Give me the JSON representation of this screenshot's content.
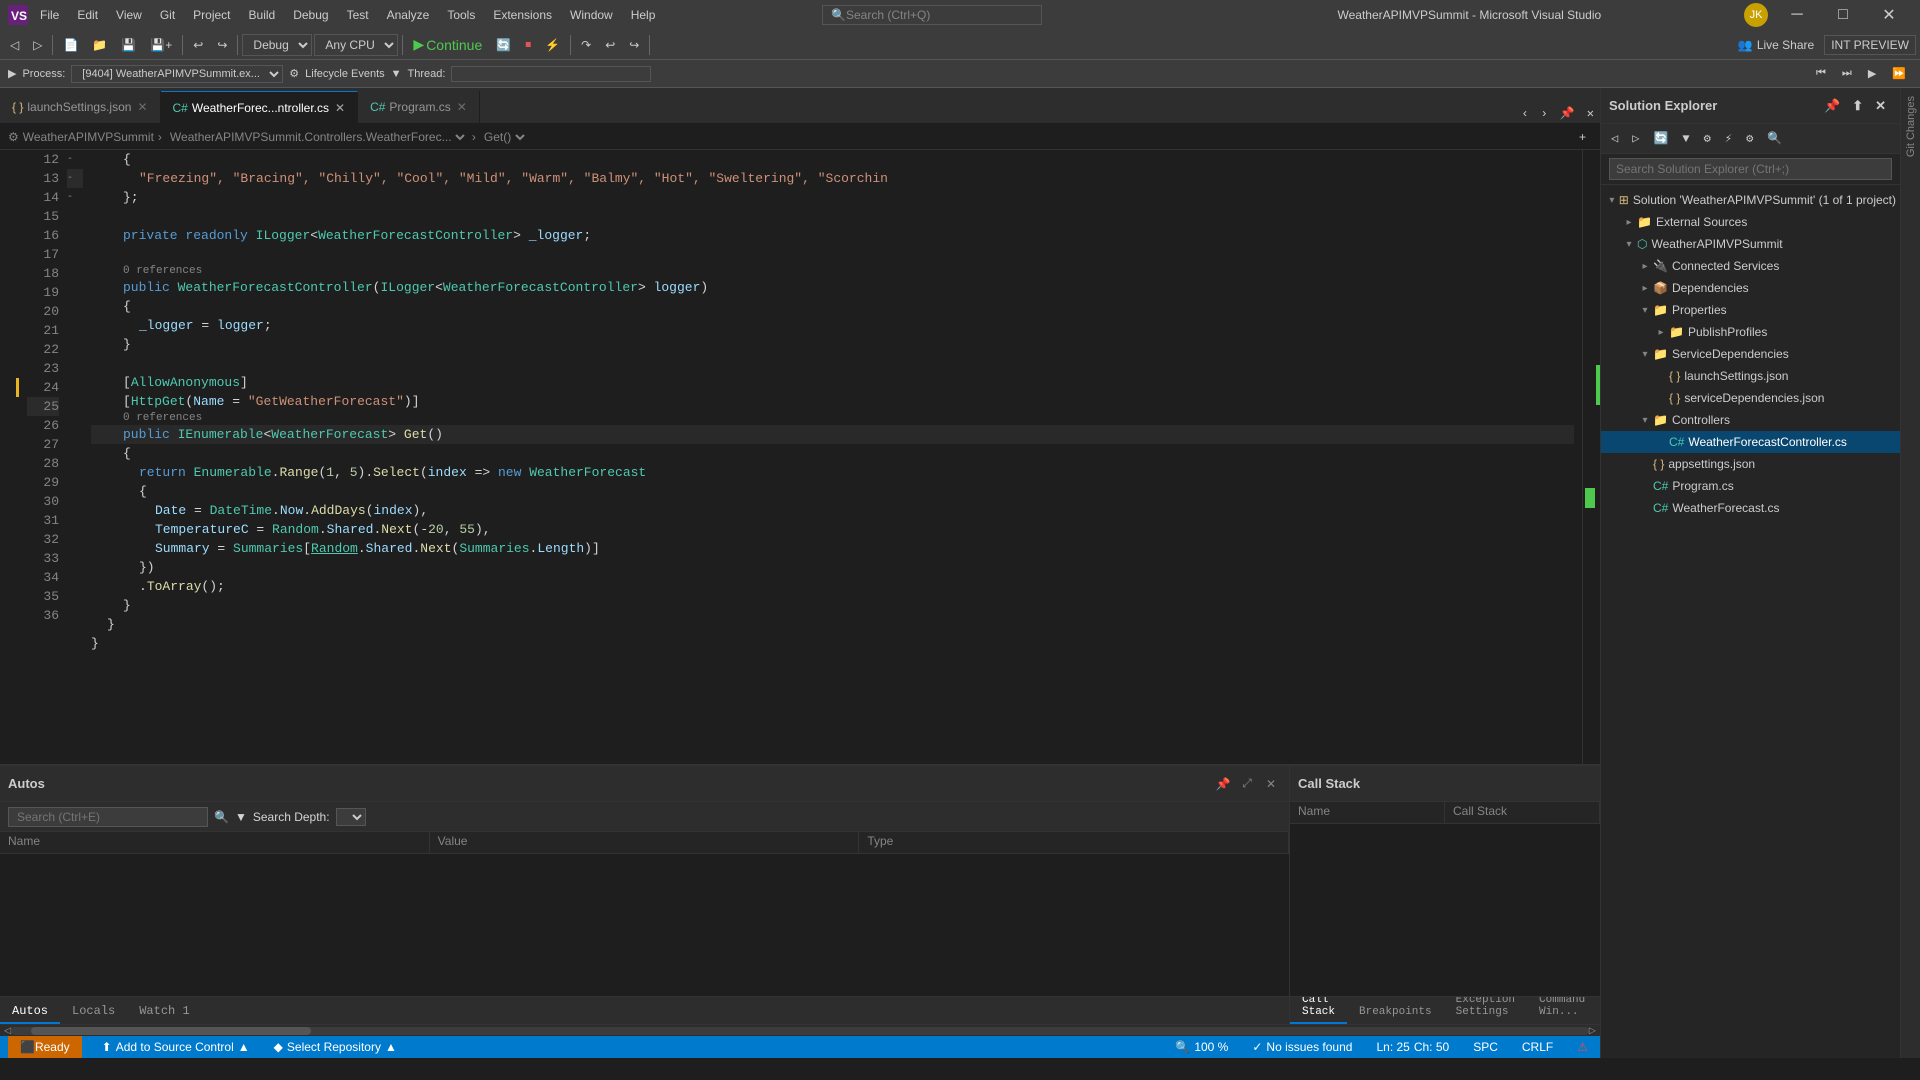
{
  "titleBar": {
    "title": "WeatherAPIMVPSummit - Microsoft Visual Studio",
    "menus": [
      "File",
      "Edit",
      "View",
      "Git",
      "Project",
      "Build",
      "Debug",
      "Test",
      "Analyze",
      "Tools",
      "Extensions",
      "Window",
      "Help"
    ],
    "searchPlaceholder": "Search (Ctrl+Q)",
    "userInitials": "JK",
    "windowControls": [
      "─",
      "□",
      "✕"
    ]
  },
  "toolbar": {
    "debugMode": "Debug",
    "platform": "Any CPU",
    "continueLabel": "Continue",
    "liveShare": "Live Share",
    "intPreview": "INT PREVIEW"
  },
  "debugBar": {
    "process": "Process:",
    "processValue": "[9404] WeatherAPIMVPSummit.ex...",
    "lifecycleLabel": "Lifecycle Events",
    "threadLabel": "Thread:"
  },
  "tabs": [
    {
      "label": "launchSettings.json",
      "active": false
    },
    {
      "label": "WeatherForec...ntroller.cs",
      "active": true
    },
    {
      "label": "Program.cs",
      "active": false
    }
  ],
  "breadcrumb": {
    "project": "WeatherAPIMVPSummit",
    "class": "WeatherAPIMVPSummit.Controllers.WeatherForec...",
    "method": "Get()"
  },
  "codeLines": [
    {
      "num": "12",
      "indent": 2,
      "code": "{"
    },
    {
      "num": "13",
      "indent": 3,
      "code": "\"Freezing\", \"Bracing\", \"Chilly\", \"Cool\", \"Mild\", \"Warm\", \"Balmy\", \"Hot\", \"Sweltering\", \"Scorchin"
    },
    {
      "num": "14",
      "indent": 2,
      "code": "};"
    },
    {
      "num": "15",
      "indent": 0,
      "code": ""
    },
    {
      "num": "16",
      "indent": 2,
      "code": "private readonly ILogger<WeatherForecastController> _logger;"
    },
    {
      "num": "17",
      "indent": 0,
      "code": ""
    },
    {
      "num": "18",
      "indent": 2,
      "refCount": "0 references",
      "code": "public WeatherForecastController(ILogger<WeatherForecastController> logger)"
    },
    {
      "num": "19",
      "indent": 2,
      "code": "{"
    },
    {
      "num": "20",
      "indent": 3,
      "code": "_logger = logger;"
    },
    {
      "num": "21",
      "indent": 2,
      "code": "}"
    },
    {
      "num": "22",
      "indent": 0,
      "code": ""
    },
    {
      "num": "23",
      "indent": 2,
      "code": "[AllowAnonymous]"
    },
    {
      "num": "24",
      "indent": 2,
      "code": "[HttpGet(Name = \"GetWeatherForecast\")]"
    },
    {
      "num": "25",
      "indent": 2,
      "refCount": "0 references",
      "code": "public IEnumerable<WeatherForecast> Get()",
      "hasBreakpoint": true,
      "isActive": true
    },
    {
      "num": "26",
      "indent": 2,
      "code": "{"
    },
    {
      "num": "27",
      "indent": 3,
      "code": "return Enumerable.Range(1, 5).Select(index => new WeatherForecast",
      "hasFold": true
    },
    {
      "num": "28",
      "indent": 3,
      "code": "{"
    },
    {
      "num": "29",
      "indent": 4,
      "code": "Date = DateTime.Now.AddDays(index),"
    },
    {
      "num": "30",
      "indent": 4,
      "code": "TemperatureC = Random.Shared.Next(-20, 55),"
    },
    {
      "num": "31",
      "indent": 4,
      "code": "Summary = Summaries[Random.Shared.Next(Summaries.Length)]"
    },
    {
      "num": "32",
      "indent": 3,
      "code": "})"
    },
    {
      "num": "33",
      "indent": 3,
      "code": ".ToArray();"
    },
    {
      "num": "34",
      "indent": 2,
      "code": "}"
    },
    {
      "num": "35",
      "indent": 1,
      "code": "}"
    },
    {
      "num": "36",
      "indent": 0,
      "code": "}"
    }
  ],
  "editorStatus": {
    "zoom": "100 %",
    "noIssues": "No issues found",
    "line": "Ln: 25",
    "col": "Ch: 50",
    "encoding": "SPC",
    "lineEnding": "CRLF",
    "ready": "Ready"
  },
  "bottomPanel": {
    "leftTitle": "Autos",
    "tabs": [
      "Autos",
      "Locals",
      "Watch 1"
    ],
    "searchPlaceholder": "Search (Ctrl+E)",
    "searchDepthLabel": "Search Depth:",
    "cols": [
      {
        "label": "Name"
      },
      {
        "label": "Value"
      },
      {
        "label": "Type"
      }
    ],
    "rightTitle": "Call Stack",
    "rightTabs": [
      "Call Stack",
      "Breakpoints",
      "Exception Settings",
      "Command Win..."
    ],
    "callStackCols": [
      {
        "label": "Name"
      },
      {
        "label": "Call Stack"
      }
    ]
  },
  "solutionExplorer": {
    "title": "Solution Explorer",
    "searchPlaceholder": "Search Solution Explorer (Ctrl+;)",
    "tree": [
      {
        "label": "Solution 'WeatherAPIMVPSummit' (1 of 1 project)",
        "level": 0,
        "expanded": true,
        "icon": "solution"
      },
      {
        "label": "External Sources",
        "level": 1,
        "expanded": false,
        "icon": "folder"
      },
      {
        "label": "WeatherAPIMVPSummit",
        "level": 1,
        "expanded": true,
        "icon": "project"
      },
      {
        "label": "Connected Services",
        "level": 2,
        "expanded": false,
        "icon": "folder"
      },
      {
        "label": "Dependencies",
        "level": 2,
        "expanded": false,
        "icon": "folder"
      },
      {
        "label": "Properties",
        "level": 2,
        "expanded": true,
        "icon": "folder"
      },
      {
        "label": "PublishProfiles",
        "level": 3,
        "expanded": false,
        "icon": "folder"
      },
      {
        "label": "ServiceDependencies",
        "level": 2,
        "expanded": true,
        "icon": "folder"
      },
      {
        "label": "launchSettings.json",
        "level": 3,
        "icon": "json"
      },
      {
        "label": "serviceDependencies.json",
        "level": 3,
        "icon": "json"
      },
      {
        "label": "Controllers",
        "level": 2,
        "expanded": true,
        "icon": "folder"
      },
      {
        "label": "WeatherForecastController.cs",
        "level": 3,
        "icon": "cs",
        "selected": true
      },
      {
        "label": "appsettings.json",
        "level": 2,
        "icon": "json"
      },
      {
        "label": "Program.cs",
        "level": 2,
        "icon": "cs"
      },
      {
        "label": "WeatherForecast.cs",
        "level": 2,
        "icon": "cs"
      }
    ]
  },
  "statusBar": {
    "ready": "Ready",
    "addToSourceControl": "Add to Source Control",
    "selectRepository": "Select Repository"
  }
}
